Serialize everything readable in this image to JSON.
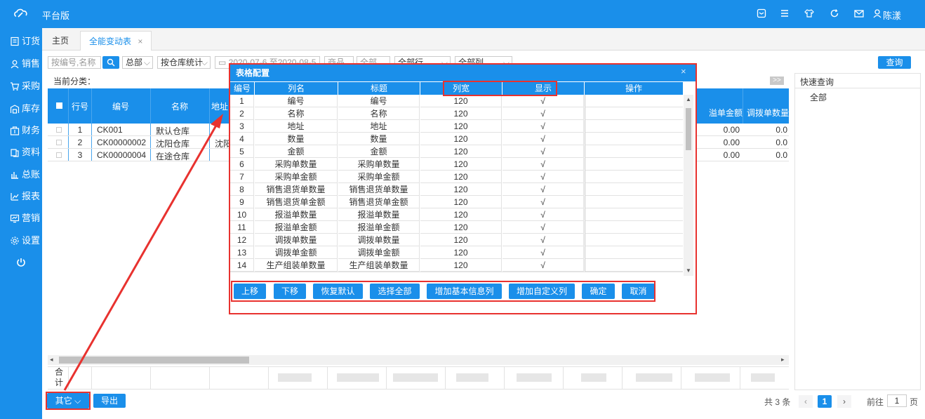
{
  "app": {
    "title": "平台版",
    "username": "陈漾"
  },
  "topbar_icons": [
    "app-window-icon",
    "menu-icon",
    "shirt-icon",
    "refresh-icon",
    "mail-icon",
    "user-icon"
  ],
  "sidebar": {
    "items": [
      {
        "label": "订货",
        "icon": "order-icon"
      },
      {
        "label": "销售",
        "icon": "people-icon"
      },
      {
        "label": "采购",
        "icon": "cart-icon"
      },
      {
        "label": "库存",
        "icon": "warehouse-icon"
      },
      {
        "label": "财务",
        "icon": "finance-icon"
      },
      {
        "label": "资料",
        "icon": "data-icon"
      },
      {
        "label": "总账",
        "icon": "ledger-icon"
      },
      {
        "label": "报表",
        "icon": "report-icon"
      },
      {
        "label": "营销",
        "icon": "marketing-icon"
      },
      {
        "label": "设置",
        "icon": "gear-icon"
      }
    ]
  },
  "tabs": [
    {
      "label": "主页"
    },
    {
      "label": "全能变动表"
    }
  ],
  "filters": {
    "search_placeholder": "按编号,名称",
    "total": "总部",
    "stat_mode": "按仓库统计",
    "date_range": "2020-07-6 至2020-08-5",
    "f1": "商品",
    "f2": "全部",
    "rows_select": "全部行",
    "cols_select": "全部列",
    "query": "查询"
  },
  "category_label": "当前分类：",
  "collapse_label": ">>",
  "table": {
    "headers": [
      "行号",
      "编号",
      "名称",
      "地址"
    ],
    "right_headers": [
      "溢单金额",
      "调拨单数量"
    ],
    "rows": [
      {
        "no": "1",
        "code": "CK001",
        "name": "默认仓库",
        "addr": "",
        "r1": "0.00",
        "r2": "0.0"
      },
      {
        "no": "2",
        "code": "CK00000002",
        "name": "沈阳仓库",
        "addr": "沈阳",
        "r1": "0.00",
        "r2": "0.0"
      },
      {
        "no": "3",
        "code": "CK00000004",
        "name": "在途仓库",
        "addr": "",
        "r1": "0.00",
        "r2": "0.0"
      }
    ],
    "total_label": "合计"
  },
  "quick": {
    "title": "快速查询",
    "item": "全部"
  },
  "dialog": {
    "title": "表格配置",
    "close": "×",
    "headers": [
      "编号",
      "列名",
      "标题",
      "列宽",
      "显示",
      "操作"
    ],
    "rows": [
      {
        "no": "1",
        "col": "编号",
        "title": "编号",
        "width": "120",
        "show": "√"
      },
      {
        "no": "2",
        "col": "名称",
        "title": "名称",
        "width": "120",
        "show": "√"
      },
      {
        "no": "3",
        "col": "地址",
        "title": "地址",
        "width": "120",
        "show": "√"
      },
      {
        "no": "4",
        "col": "数量",
        "title": "数量",
        "width": "120",
        "show": "√"
      },
      {
        "no": "5",
        "col": "金额",
        "title": "金额",
        "width": "120",
        "show": "√"
      },
      {
        "no": "6",
        "col": "采购单数量",
        "title": "采购单数量",
        "width": "120",
        "show": "√"
      },
      {
        "no": "7",
        "col": "采购单金额",
        "title": "采购单金额",
        "width": "120",
        "show": "√"
      },
      {
        "no": "8",
        "col": "销售退货单数量",
        "title": "销售退货单数量",
        "width": "120",
        "show": "√"
      },
      {
        "no": "9",
        "col": "销售退货单金额",
        "title": "销售退货单金额",
        "width": "120",
        "show": "√"
      },
      {
        "no": "10",
        "col": "报溢单数量",
        "title": "报溢单数量",
        "width": "120",
        "show": "√"
      },
      {
        "no": "11",
        "col": "报溢单金额",
        "title": "报溢单金额",
        "width": "120",
        "show": "√"
      },
      {
        "no": "12",
        "col": "调拨单数量",
        "title": "调拨单数量",
        "width": "120",
        "show": "√"
      },
      {
        "no": "13",
        "col": "调拨单金额",
        "title": "调拨单金额",
        "width": "120",
        "show": "√"
      },
      {
        "no": "14",
        "col": "生产组装单数量",
        "title": "生产组装单数量",
        "width": "120",
        "show": "√"
      }
    ],
    "buttons": [
      "上移",
      "下移",
      "恢复默认",
      "选择全部",
      "增加基本信息列",
      "增加自定义列",
      "确定",
      "取消"
    ]
  },
  "footer": {
    "other": "其它",
    "export": "导出",
    "total_text": "共 3 条",
    "page": "1",
    "goto": "前往",
    "goto_page": "1",
    "page_unit": "页"
  },
  "colors": {
    "accent": "#1a8fea",
    "highlight": "#e8322f"
  }
}
